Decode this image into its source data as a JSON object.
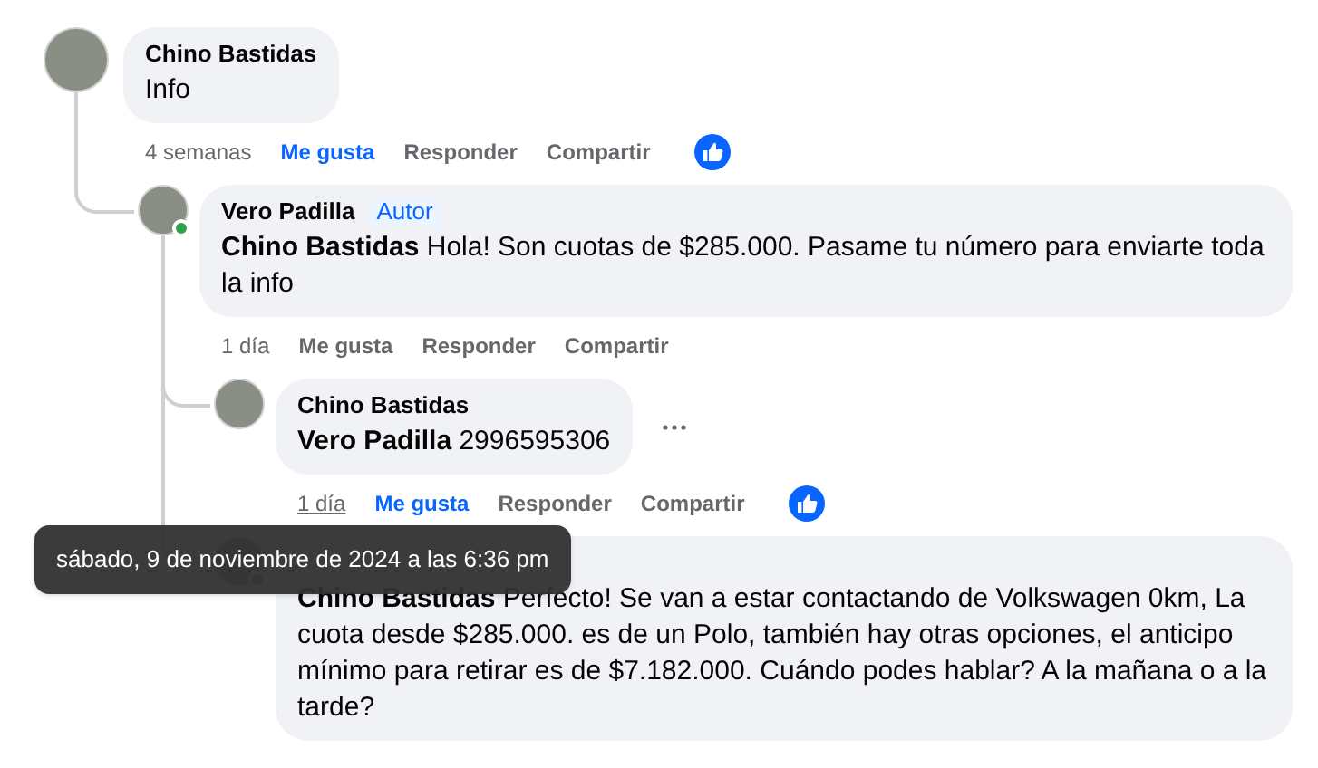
{
  "comments": [
    {
      "author": "Chino Bastidas",
      "text": "Info",
      "time": "4 semanas",
      "time_hovered": false,
      "actions": [
        {
          "label": "Me gusta",
          "selected": true
        },
        {
          "label": "Responder",
          "selected": false
        },
        {
          "label": "Compartir",
          "selected": false
        }
      ],
      "reaction": true,
      "children": [
        {
          "author": "Vero Padilla",
          "badge": "Autor",
          "mention": "Chino Bastidas",
          "text": "Hola! Son cuotas de $285.000. Pasame tu número para enviarte toda la info",
          "time": "1 día",
          "time_hovered": false,
          "actions": [
            {
              "label": "Me gusta",
              "selected": false
            },
            {
              "label": "Responder",
              "selected": false
            },
            {
              "label": "Compartir",
              "selected": false
            }
          ],
          "online": true,
          "children": [
            {
              "author": "Chino Bastidas",
              "mention": "Vero Padilla",
              "text": "2996595306",
              "time": "1 día",
              "time_hovered": true,
              "actions": [
                {
                  "label": "Me gusta",
                  "selected": true
                },
                {
                  "label": "Responder",
                  "selected": false
                },
                {
                  "label": "Compartir",
                  "selected": false
                }
              ],
              "reaction": true,
              "more_menu": true
            },
            {
              "mention": "Chino Bastidas",
              "text": "Perfecto! Se van a estar contactando de Volkswagen 0km, La cuota desde $285.000. es de un Polo, también hay otras opciones, el anticipo mínimo para retirar es de $7.182.000. Cuándo podes hablar? A la mañana o a la tarde?",
              "online": true
            }
          ]
        }
      ]
    }
  ],
  "tooltip": "sábado, 9 de noviembre de 2024 a las 6:36 pm"
}
